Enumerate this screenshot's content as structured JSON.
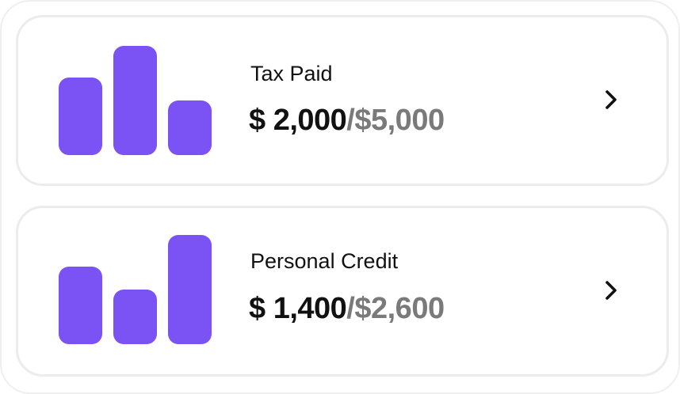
{
  "theme": {
    "accent": "#7b52f4"
  },
  "cards": [
    {
      "title": "Tax Paid",
      "amount": "$ 2,000",
      "total": "/$5,000",
      "bars": [
        0.71,
        1.0,
        0.5
      ],
      "icon": "chevron-right-icon"
    },
    {
      "title": "Personal Credit",
      "amount": "$ 1,400",
      "total": "/$2,600",
      "bars": [
        0.71,
        0.5,
        1.0
      ],
      "icon": "chevron-right-icon"
    }
  ]
}
